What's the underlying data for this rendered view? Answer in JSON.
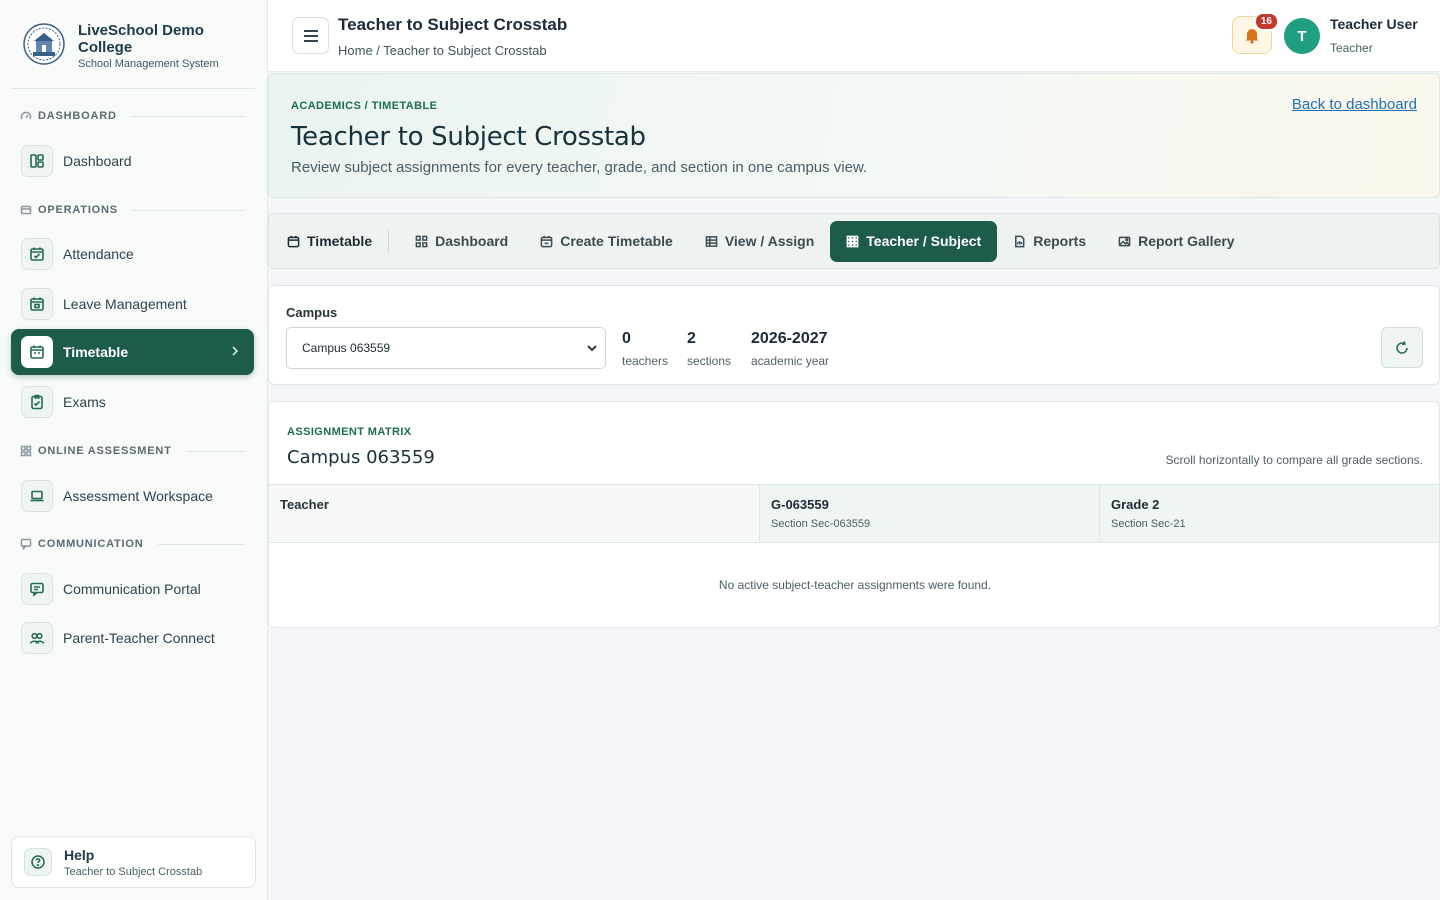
{
  "brand": {
    "name": "LiveSchool Demo College",
    "subtitle": "School Management System"
  },
  "sidebar": {
    "sections": [
      {
        "label": "DASHBOARD"
      },
      {
        "label": "OPERATIONS"
      },
      {
        "label": "ONLINE ASSESSMENT"
      },
      {
        "label": "COMMUNICATION"
      }
    ],
    "items": [
      {
        "label": "Dashboard",
        "icon": "layout-icon"
      },
      {
        "label": "Attendance",
        "icon": "calendar-check-icon"
      },
      {
        "label": "Leave Management",
        "icon": "calendar-leave-icon"
      },
      {
        "label": "Timetable",
        "icon": "calendar-icon",
        "active": true
      },
      {
        "label": "Exams",
        "icon": "clipboard-icon"
      },
      {
        "label": "Assessment Workspace",
        "icon": "laptop-icon"
      },
      {
        "label": "Communication Portal",
        "icon": "message-icon"
      },
      {
        "label": "Parent-Teacher Connect",
        "icon": "users-icon"
      }
    ],
    "help": {
      "title": "Help",
      "subtitle": "Teacher to Subject Crosstab"
    }
  },
  "topbar": {
    "title": "Teacher to Subject Crosstab",
    "breadcrumb": "Home / Teacher to Subject Crosstab",
    "notifications": "16",
    "user": {
      "initial": "T",
      "name": "Teacher User",
      "role": "Teacher"
    }
  },
  "hero": {
    "kicker": "ACADEMICS / TIMETABLE",
    "title": "Teacher to Subject Crosstab",
    "description": "Review subject assignments for every teacher, grade, and section in one campus view.",
    "back_link": "Back to dashboard"
  },
  "tabs": [
    {
      "label": "Timetable",
      "icon": "calendar-icon"
    },
    {
      "label": "Dashboard",
      "icon": "grid-icon"
    },
    {
      "label": "Create Timetable",
      "icon": "calendar-plus-icon"
    },
    {
      "label": "View / Assign",
      "icon": "table-icon"
    },
    {
      "label": "Teacher / Subject",
      "icon": "grid-dots-icon",
      "active": true
    },
    {
      "label": "Reports",
      "icon": "report-icon"
    },
    {
      "label": "Report Gallery",
      "icon": "image-icon"
    }
  ],
  "filter": {
    "campus_label": "Campus",
    "campus_value": "Campus 063559",
    "stats": [
      {
        "value": "0",
        "label": "teachers"
      },
      {
        "value": "2",
        "label": "sections"
      },
      {
        "value": "2026-2027",
        "label": "academic year"
      }
    ]
  },
  "matrix": {
    "kicker": "ASSIGNMENT MATRIX",
    "title": "Campus 063559",
    "hint": "Scroll horizontally to compare all grade sections.",
    "teacher_header": "Teacher",
    "columns": [
      {
        "grade": "G-063559",
        "section": "Section Sec-063559"
      },
      {
        "grade": "Grade 2",
        "section": "Section Sec-21"
      }
    ],
    "empty_message": "No active subject-teacher assignments were found."
  },
  "colors": {
    "brand_green": "#1d5c4d",
    "accent_teal": "#1f9e80",
    "link_blue": "#1f6fb3",
    "badge_red": "#c0392b"
  }
}
